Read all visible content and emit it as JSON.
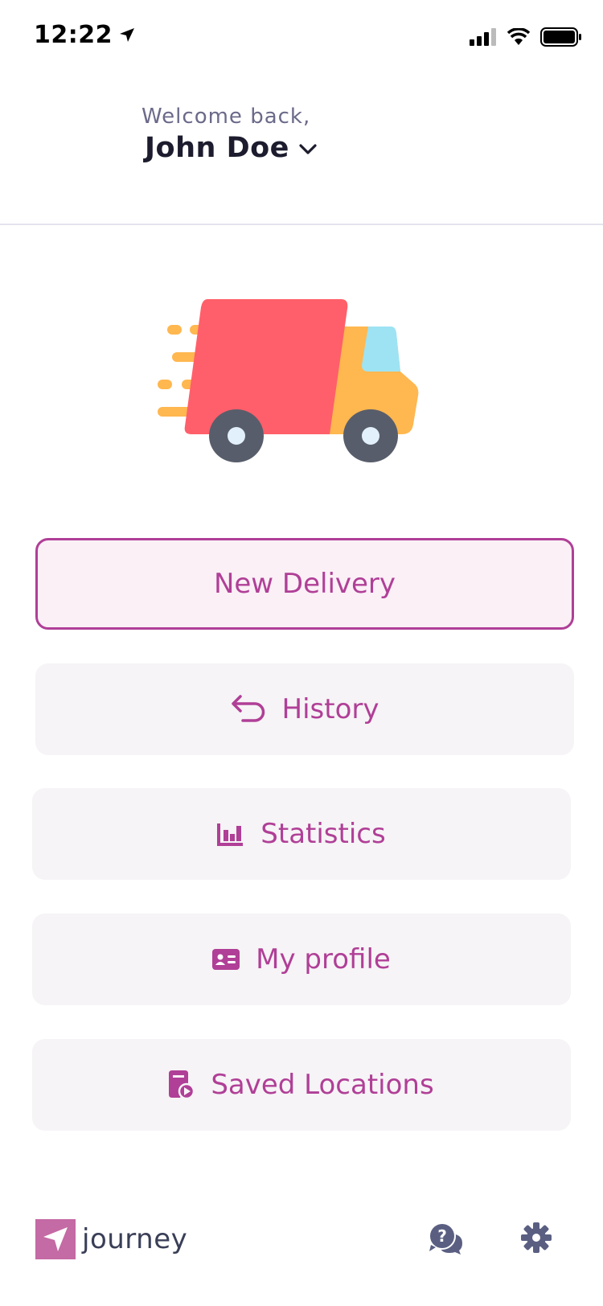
{
  "status_bar": {
    "time": "12:22"
  },
  "header": {
    "welcome": "Welcome back,",
    "user_name": "John Doe"
  },
  "menu": [
    {
      "label": "New Delivery",
      "icon": "none"
    },
    {
      "label": "History",
      "icon": "undo-arrow-icon"
    },
    {
      "label": "Statistics",
      "icon": "bar-chart-icon"
    },
    {
      "label": "My profile",
      "icon": "id-card-icon"
    },
    {
      "label": "Saved Locations",
      "icon": "saved-locations-icon"
    }
  ],
  "footer": {
    "logo_text": "journey"
  },
  "colors": {
    "accent": "#b03f97",
    "button_bg": "#f6f4f6",
    "primary_bg": "#faf0f6",
    "logo": "#c46aa4",
    "icon_gray": "#5a5f82"
  }
}
